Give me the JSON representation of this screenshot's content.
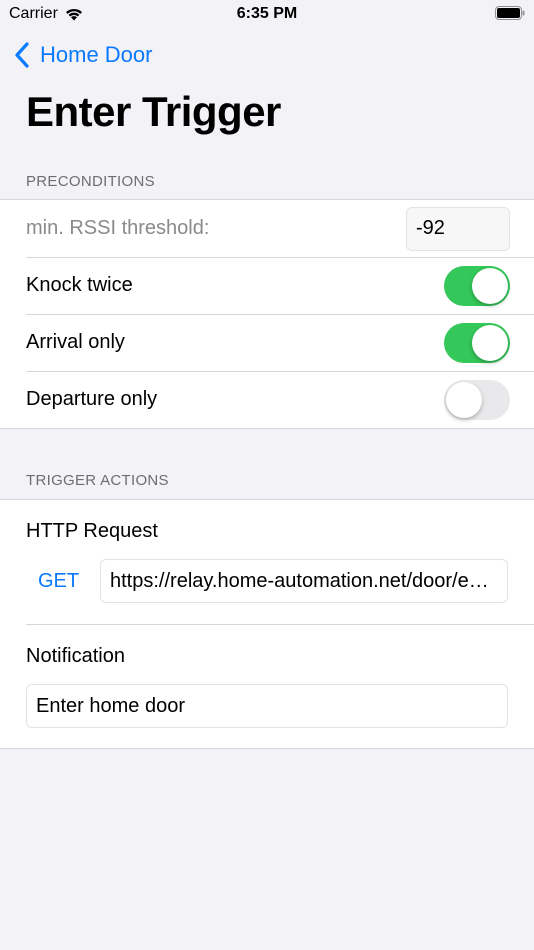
{
  "status_bar": {
    "carrier": "Carrier",
    "time": "6:35 PM"
  },
  "nav": {
    "back_label": "Home Door"
  },
  "page": {
    "title": "Enter Trigger"
  },
  "preconditions": {
    "header": "PRECONDITIONS",
    "rssi_label": "min. RSSI threshold:",
    "rssi_value": "-92",
    "knock_label": "Knock twice",
    "knock_on": true,
    "arrival_label": "Arrival only",
    "arrival_on": true,
    "departure_label": "Departure only",
    "departure_on": false
  },
  "actions": {
    "header": "TRIGGER ACTIONS",
    "http_title": "HTTP Request",
    "http_method": "GET",
    "http_url": "https://relay.home-automation.net/door/enter",
    "notification_title": "Notification",
    "notification_value": "Enter home door"
  },
  "colors": {
    "accent": "#0a7aff",
    "toggle_on": "#34c759",
    "toggle_off": "#e9e9eb",
    "background": "#f2f2f7"
  }
}
